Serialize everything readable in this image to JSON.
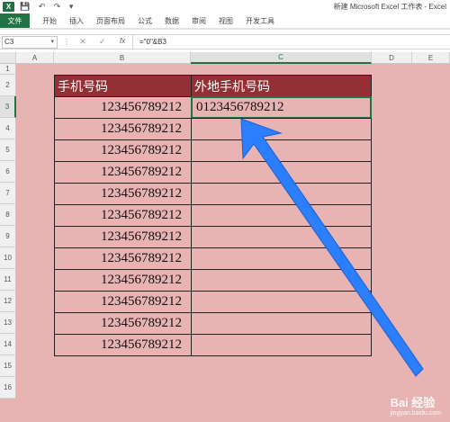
{
  "titlebar": {
    "app_icon": "X",
    "title": "新建 Microsoft Excel 工作表 - Excel",
    "qa_save": "💾",
    "qa_undo": "↶",
    "qa_redo": "↷",
    "qa_more": "▾"
  },
  "ribbon": {
    "file": "文件",
    "tabs": [
      "开始",
      "插入",
      "页面布局",
      "公式",
      "数据",
      "审阅",
      "视图",
      "开发工具"
    ]
  },
  "formula_bar": {
    "name_box": "C3",
    "fx": "fx",
    "cancel": "✕",
    "enter": "✓",
    "formula": "=\"0\"&B3"
  },
  "columns": [
    "A",
    "B",
    "C",
    "D",
    "E"
  ],
  "rows": [
    "1",
    "2",
    "3",
    "4",
    "5",
    "6",
    "7",
    "8",
    "9",
    "10",
    "11",
    "12",
    "13",
    "14",
    "15",
    "16"
  ],
  "sheet": {
    "header_b": "手机号码",
    "header_c": "外地手机号码",
    "values_b": [
      "123456789212",
      "123456789212",
      "123456789212",
      "123456789212",
      "123456789212",
      "123456789212",
      "123456789212",
      "123456789212",
      "123456789212",
      "123456789212",
      "123456789212",
      "123456789212"
    ],
    "c3": "0123456789212"
  },
  "watermark": {
    "brand": "Bai 经验",
    "url": "jingyan.baidu.com"
  },
  "colors": {
    "excel_green": "#217346",
    "header_fill": "#933036",
    "sheet_fill": "#e7b3b3",
    "arrow": "#2b7fff"
  }
}
